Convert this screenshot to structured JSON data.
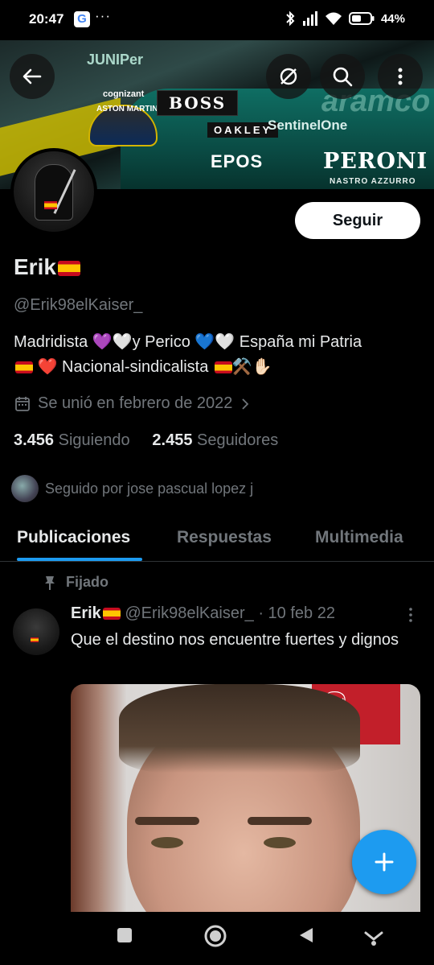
{
  "status_bar": {
    "time": "20:47",
    "g_label": "G",
    "notif_dots": "···",
    "battery": "44%",
    "icons": [
      "bluetooth-icon",
      "signal-icon",
      "wifi-icon",
      "battery-icon"
    ]
  },
  "banner": {
    "sponsors": {
      "juniper": "JUNIPer",
      "cognizant": "cognizant",
      "aston": "ASTON MARTIN",
      "boss": "BOSS",
      "oakley": "OAKLEY",
      "sentinel": "SentinelOne",
      "epos": "EPOS",
      "peroni": "PERONI",
      "nastro": "NASTRO AZZURRO",
      "aramco": "aramco"
    }
  },
  "profile": {
    "name": "Erik",
    "handle": "@Erik98elKaiser_",
    "bio_line1": "Madridista 💜🤍y Perico 💙🤍 España mi Patria",
    "bio_line2": "❤️ Nacional-sindicalista",
    "bio_line2_tail": "⚒️✋🏻",
    "joined": "Se unió en febrero de 2022",
    "following_count": "3.456",
    "following_label": "Siguiendo",
    "followers_count": "2.455",
    "followers_label": "Seguidores",
    "followed_by": "Seguido por jose pascual lopez j",
    "follow_button": "Seguir"
  },
  "tabs": [
    {
      "label": "Publicaciones",
      "active": true
    },
    {
      "label": "Respuestas",
      "active": false
    },
    {
      "label": "Multimedia",
      "active": false
    }
  ],
  "pinned_post": {
    "pinned_label": "Fijado",
    "author": "Erik",
    "handle": "@Erik98elKaiser_",
    "date": "· 10 feb 22",
    "text": "Que el destino nos encuentre fuertes y dignos"
  },
  "colors": {
    "accent": "#1d9bf0",
    "background": "#000000",
    "secondary_text": "#71767b"
  }
}
